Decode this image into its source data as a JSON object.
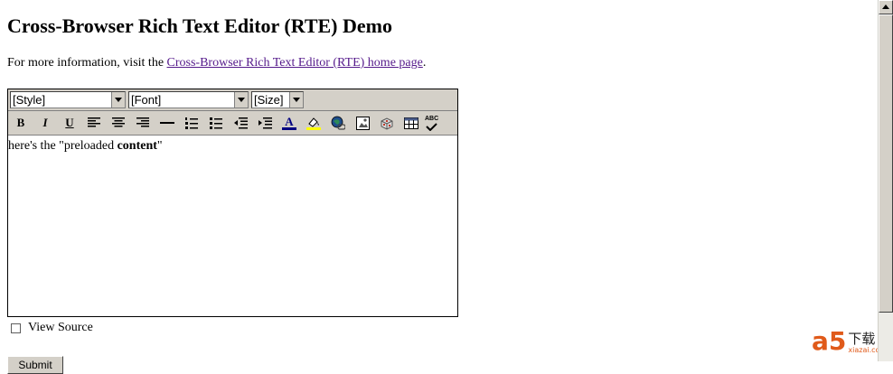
{
  "page": {
    "title": "Cross-Browser Rich Text Editor (RTE) Demo",
    "intro_prefix": "For more information, visit the ",
    "intro_link": "Cross-Browser Rich Text Editor (RTE) home page",
    "intro_suffix": "."
  },
  "toolbar": {
    "style_select": "[Style]",
    "font_select": "[Font]",
    "size_select": "[Size]",
    "buttons": [
      {
        "label": "B",
        "icon": "bold-icon"
      },
      {
        "label": "I",
        "icon": "italic-icon"
      },
      {
        "label": "U",
        "icon": "underline-icon"
      },
      {
        "icon": "align-left-icon"
      },
      {
        "icon": "align-center-icon"
      },
      {
        "icon": "align-right-icon"
      },
      {
        "icon": "horizontal-rule-icon"
      },
      {
        "icon": "ordered-list-icon"
      },
      {
        "icon": "unordered-list-icon"
      },
      {
        "icon": "outdent-icon"
      },
      {
        "icon": "indent-icon"
      },
      {
        "label": "A",
        "icon": "text-color-icon"
      },
      {
        "icon": "highlight-color-icon"
      },
      {
        "icon": "insert-link-icon"
      },
      {
        "icon": "insert-image-icon"
      },
      {
        "icon": "special-char-icon"
      },
      {
        "icon": "insert-table-icon"
      },
      {
        "label": "ABC",
        "icon": "spellcheck-icon"
      }
    ]
  },
  "editor": {
    "content_prefix": "here's the \"preloaded ",
    "content_bold": "content",
    "content_suffix": "\""
  },
  "view_source_label": "View Source",
  "submit_label": "Submit",
  "watermark": {
    "logo": "a5",
    "cn": "下载",
    "url": "xiazai.com"
  },
  "colors": {
    "link": "#551a8b",
    "toolbar": "#d4d0c8",
    "text_color_bar": "#000080",
    "highlight_bar": "#ffff00",
    "watermark_accent": "#e05a1a"
  }
}
